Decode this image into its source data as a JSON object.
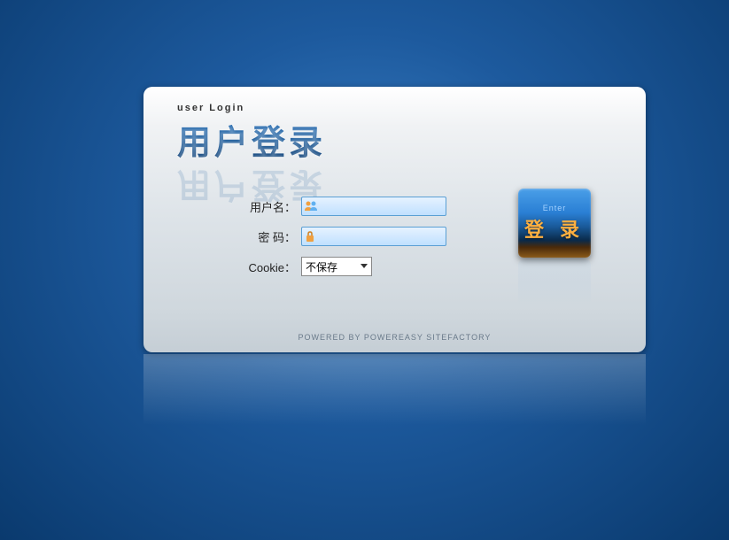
{
  "header": {
    "subtitle": "user Login",
    "title": "用户登录"
  },
  "form": {
    "username_label": "用户名：",
    "password_label": "密 码：",
    "cookie_label": "Cookie：",
    "cookie_selected": "不保存"
  },
  "button": {
    "enter_text": "Enter",
    "login_text": "登 录"
  },
  "footer": {
    "text": "POWERED BY POWEREASY SITEFACTORY"
  },
  "icons": {
    "user": "user-icon",
    "lock": "lock-icon"
  }
}
